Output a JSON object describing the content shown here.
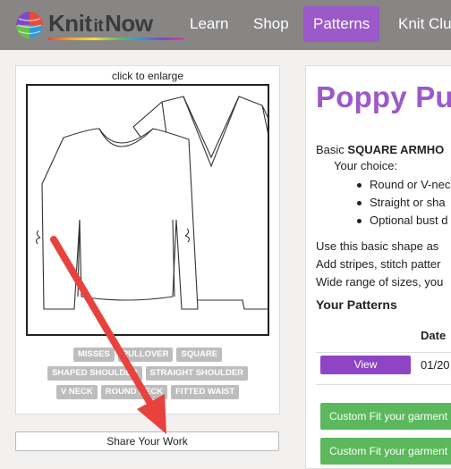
{
  "nav": {
    "logo": {
      "brand_words": [
        "Knit",
        "it",
        "Now"
      ]
    },
    "items": [
      {
        "label": "Learn"
      },
      {
        "label": "Shop"
      },
      {
        "label": "Patterns",
        "active": true
      },
      {
        "label": "Knit Clu"
      }
    ],
    "colors": {
      "bar": "#888585",
      "active": "#9b59c9"
    }
  },
  "left_card": {
    "enlarge_hint": "click to enlarge",
    "tags": [
      "MISSES",
      "PULLOVER",
      "SQUARE",
      "SHAPED SHOULDER",
      "STRAIGHT SHOULDER",
      "V NECK",
      "ROUND NECK",
      "FITTED WAIST"
    ],
    "share_label": "Share Your Work"
  },
  "right_card": {
    "title": "Poppy Pul",
    "desc_prefix": "Basic ",
    "desc_bold": "SQUARE ARMHO",
    "choice_label": "Your choice:",
    "bullets": [
      "Round or V-nec",
      "Straight or sha",
      "Optional bust d"
    ],
    "use_lines": [
      "Use this basic shape as",
      "Add stripes, stitch patter",
      "Wide range of sizes, you"
    ],
    "your_patterns_heading": "Your Patterns",
    "table": {
      "header_date": "Date",
      "rows": [
        {
          "button": "View",
          "date": "01/20"
        }
      ]
    },
    "fit_buttons": [
      "Custom Fit your garment",
      "Custom Fit your garment"
    ],
    "colors": {
      "title": "#9b59c9",
      "view_button": "#8e44c4",
      "fit_button": "#5cb85c"
    }
  },
  "annotation": {
    "arrow_color": "#e8423f"
  }
}
